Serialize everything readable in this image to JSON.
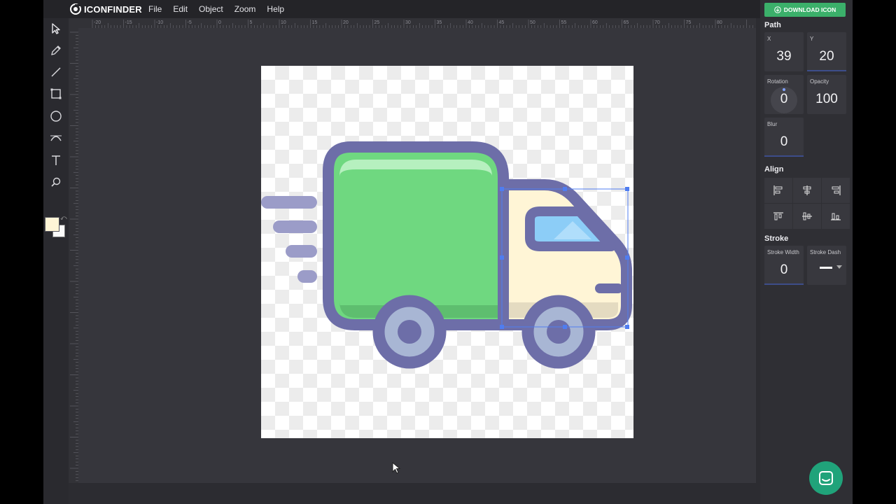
{
  "app": {
    "logo_text": "ICONFINDER",
    "menu": [
      "File",
      "Edit",
      "Object",
      "Zoom",
      "Help"
    ]
  },
  "ruler": {
    "top_labels": [
      "-20",
      "-15",
      "-10",
      "-5",
      "0",
      "5",
      "10",
      "15",
      "20",
      "25",
      "30",
      "35",
      "40",
      "45",
      "50",
      "55",
      "60",
      "65",
      "70",
      "75",
      "80"
    ]
  },
  "toolbar": {
    "tools": [
      "select-tool",
      "pencil-tool",
      "line-tool",
      "rectangle-tool",
      "ellipse-tool",
      "bezier-tool",
      "text-tool",
      "zoom-tool"
    ],
    "fill_color": "#fff5d6",
    "stroke_color": "#fafafa"
  },
  "panel": {
    "download_label": "DOWNLOAD ICON",
    "path_title": "Path",
    "x_label": "X",
    "x_value": "39",
    "y_label": "Y",
    "y_value": "20",
    "rotation_label": "Rotation",
    "rotation_value": "0",
    "opacity_label": "Opacity",
    "opacity_value": "100",
    "blur_label": "Blur",
    "blur_value": "0",
    "align_title": "Align",
    "stroke_title": "Stroke",
    "stroke_width_label": "Stroke Width",
    "stroke_width_value": "0",
    "stroke_dash_label": "Stroke Dash"
  },
  "colors": {
    "accent_green": "#3bb06a",
    "truck_outline": "#6d6ea8",
    "cargo_green": "#6fd880",
    "cabin_cream": "#fff5d6",
    "window_blue": "#8ccdf7",
    "wheel_inner": "#a8b6d4",
    "selection": "#4f7df0"
  }
}
